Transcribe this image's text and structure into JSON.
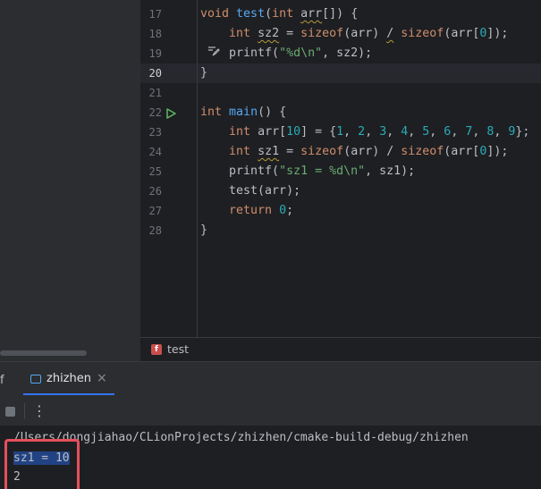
{
  "editor": {
    "line_numbers": [
      "17",
      "18",
      "19",
      "20",
      "21",
      "22",
      "23",
      "24",
      "25",
      "26",
      "27",
      "28"
    ],
    "current_line": "20",
    "lines": [
      [
        {
          "t": "void",
          "c": "kw"
        },
        {
          "t": " "
        },
        {
          "t": "test",
          "c": "fn"
        },
        {
          "t": "("
        },
        {
          "t": "int",
          "c": "kw"
        },
        {
          "t": " "
        },
        {
          "t": "arr",
          "c": "squig"
        },
        {
          "t": "[]) {"
        }
      ],
      [
        {
          "t": "    "
        },
        {
          "t": "int",
          "c": "kw"
        },
        {
          "t": " "
        },
        {
          "t": "sz2",
          "c": "squig"
        },
        {
          "t": " = "
        },
        {
          "t": "sizeof",
          "c": "kw"
        },
        {
          "t": "(arr) "
        },
        {
          "t": "/",
          "c": "squig"
        },
        {
          "t": " "
        },
        {
          "t": "sizeof",
          "c": "kw"
        },
        {
          "t": "(arr["
        },
        {
          "t": "0",
          "c": "num"
        },
        {
          "t": "]);"
        }
      ],
      [
        {
          "t": "    printf("
        },
        {
          "t": "\"%d\\n\"",
          "c": "str"
        },
        {
          "t": ", sz2);"
        }
      ],
      [
        {
          "t": "}"
        }
      ],
      [],
      [
        {
          "t": "int",
          "c": "kw"
        },
        {
          "t": " "
        },
        {
          "t": "main",
          "c": "fn"
        },
        {
          "t": "() {"
        }
      ],
      [
        {
          "t": "    "
        },
        {
          "t": "int",
          "c": "kw"
        },
        {
          "t": " arr["
        },
        {
          "t": "10",
          "c": "num"
        },
        {
          "t": "] = {"
        },
        {
          "t": "1",
          "c": "num"
        },
        {
          "t": ", "
        },
        {
          "t": "2",
          "c": "num"
        },
        {
          "t": ", "
        },
        {
          "t": "3",
          "c": "num"
        },
        {
          "t": ", "
        },
        {
          "t": "4",
          "c": "num"
        },
        {
          "t": ", "
        },
        {
          "t": "5",
          "c": "num"
        },
        {
          "t": ", "
        },
        {
          "t": "6",
          "c": "num"
        },
        {
          "t": ", "
        },
        {
          "t": "7",
          "c": "num"
        },
        {
          "t": ", "
        },
        {
          "t": "8",
          "c": "num"
        },
        {
          "t": ", "
        },
        {
          "t": "9",
          "c": "num"
        },
        {
          "t": "};"
        }
      ],
      [
        {
          "t": "    "
        },
        {
          "t": "int",
          "c": "kw"
        },
        {
          "t": " "
        },
        {
          "t": "sz1",
          "c": "squig"
        },
        {
          "t": " = "
        },
        {
          "t": "sizeof",
          "c": "kw"
        },
        {
          "t": "(arr) / "
        },
        {
          "t": "sizeof",
          "c": "kw"
        },
        {
          "t": "(arr["
        },
        {
          "t": "0",
          "c": "num"
        },
        {
          "t": "]);"
        }
      ],
      [
        {
          "t": "    printf("
        },
        {
          "t": "\"sz1 = %d\\n\"",
          "c": "str"
        },
        {
          "t": ", sz1);"
        }
      ],
      [
        {
          "t": "    test(arr);"
        }
      ],
      [
        {
          "t": "    "
        },
        {
          "t": "return",
          "c": "kw"
        },
        {
          "t": " "
        },
        {
          "t": "0",
          "c": "num"
        },
        {
          "t": ";"
        }
      ],
      [
        {
          "t": "}"
        }
      ]
    ]
  },
  "breadcrumb": {
    "icon_letter": "f",
    "label": "test"
  },
  "run_panel": {
    "partial_tab_label": "f",
    "tab_label": "zhizhen",
    "close_glyph": "×",
    "kebab_glyph": "⋮"
  },
  "console": {
    "path": "/Users/dongjiahao/CLionProjects/zhizhen/cmake-build-debug/zhizhen",
    "out1": "sz1 = 10",
    "out2": "2"
  },
  "colors": {
    "keyword": "#cf8e6d",
    "function": "#56a8f5",
    "number": "#2aacb8",
    "string": "#6aab73",
    "highlight_box": "#e5505c",
    "selection": "#214283"
  },
  "icons": [
    "run-gutter-icon",
    "quick-fix-icon",
    "function-icon",
    "terminal-tab-icon",
    "close-icon",
    "stop-icon",
    "more-options-icon"
  ]
}
